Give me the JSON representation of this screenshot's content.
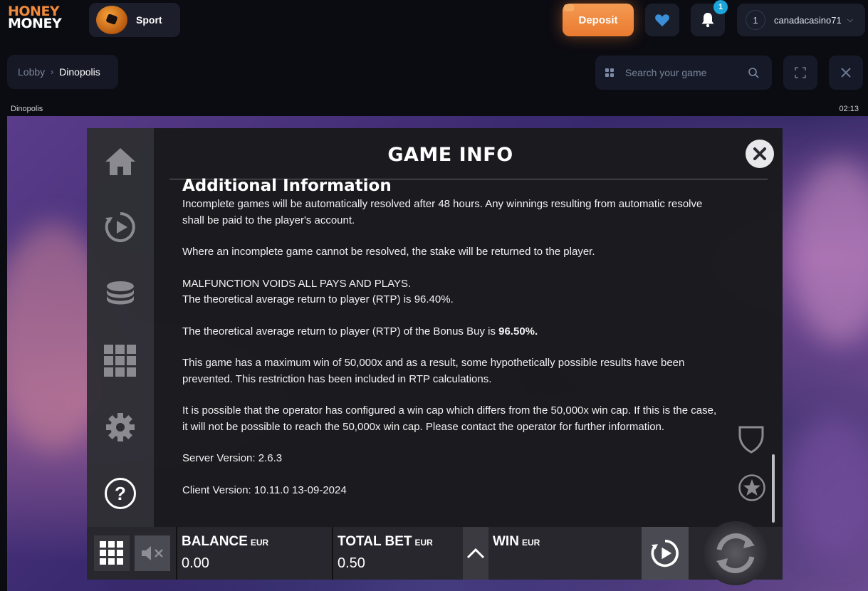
{
  "header": {
    "logo_line1": "HONEY",
    "logo_line2": "MONEY",
    "sport_label": "Sport",
    "deposit_label": "Deposit",
    "notification_count": "1",
    "user_level": "1",
    "username": "canadacasino71",
    "accent_color": "#ef8a3c"
  },
  "breadcrumb": {
    "lobby": "Lobby",
    "current": "Dinopolis"
  },
  "search": {
    "placeholder": "Search your game"
  },
  "game_bar": {
    "title": "Dinopolis",
    "time": "02:13"
  },
  "game_info": {
    "title": "GAME INFO",
    "section_heading": "Additional Information",
    "paragraphs": {
      "p1": "Incomplete games will be automatically resolved after 48 hours. Any winnings resulting from automatic resolve shall be paid to the player's account.",
      "p2": "Where an incomplete game cannot be resolved, the stake will be returned to the player.",
      "p3a": "MALFUNCTION VOIDS ALL PAYS AND PLAYS.",
      "p3b": "The theoretical average return to player (RTP) is 96.40%.",
      "p4_text": "The theoretical average return to player (RTP) of the Bonus Buy is ",
      "p4_value": "96.50%.",
      "p5": "This game has a maximum win of 50,000x and as a result, some hypothetically possible results have been prevented. This restriction has been included in RTP calculations.",
      "p6": "It is possible that the operator has configured a win cap which differs from the 50,000x win cap. If this is the case, it will not be possible to reach the 50,000x win cap. Please contact the operator for further information.",
      "server_version": "Server Version: 2.6.3",
      "client_version": "Client Version: 10.11.0 13-09-2024"
    }
  },
  "bottom_bar": {
    "balance_label": "BALANCE",
    "balance_unit": "EUR",
    "balance_value": "0.00",
    "total_bet_label": "TOTAL BET",
    "total_bet_unit": "EUR",
    "total_bet_value": "0.50",
    "win_label": "WIN",
    "win_unit": "EUR"
  },
  "icons": [
    "home-icon",
    "replay-icon",
    "coins-icon",
    "paytable-grid-icon",
    "settings-icon",
    "help-icon",
    "close-icon",
    "shield-icon",
    "star-icon",
    "menu-grid-icon",
    "mute-icon",
    "autoplay-icon",
    "spin-icon",
    "heart-icon",
    "bell-icon",
    "fullscreen-icon",
    "search-icon"
  ]
}
